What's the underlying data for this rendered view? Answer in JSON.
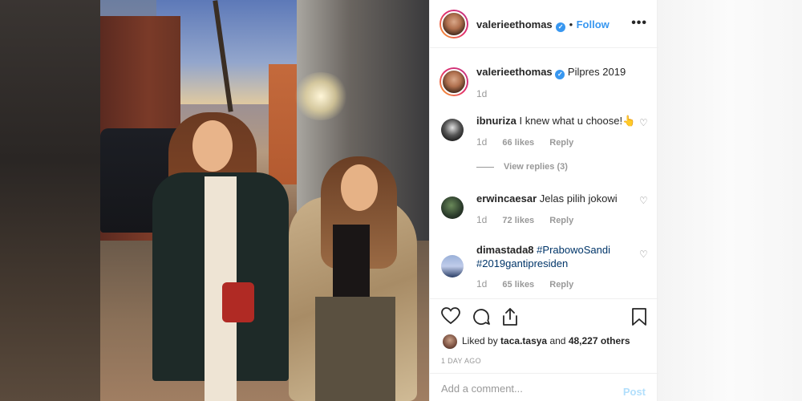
{
  "post": {
    "author": "valerieethomas",
    "follow_label": "Follow",
    "dot": "•",
    "more_label": "•••",
    "caption": {
      "user": "valerieethomas",
      "text": "Pilpres 2019",
      "time": "1d"
    }
  },
  "comments": [
    {
      "user": "ibnuriza",
      "text": "I knew what u choose!",
      "emoji": "👆",
      "time": "1d",
      "likes": "66 likes",
      "reply": "Reply",
      "view_replies": "View replies (3)"
    },
    {
      "user": "erwincaesar",
      "text": "Jelas pilih jokowi",
      "time": "1d",
      "likes": "72 likes",
      "reply": "Reply"
    },
    {
      "user": "dimastada8",
      "hashtag1": "#PrabowoSandi",
      "hashtag2": "#2019gantipresiden",
      "time": "1d",
      "likes": "65 likes",
      "reply": "Reply"
    }
  ],
  "likes_line": {
    "prefix": "Liked by",
    "user": "taca.tasya",
    "and": "and",
    "count": "48,227 others"
  },
  "date": "1 DAY AGO",
  "add_comment": {
    "placeholder": "Add a comment...",
    "post_label": "Post"
  },
  "icons": [
    "heart-icon",
    "comment-icon",
    "share-icon",
    "bookmark-icon",
    "more-icon",
    "verified-icon"
  ],
  "colors": {
    "accent": "#3897f0",
    "hashtag": "#003569",
    "muted": "#999999",
    "post_disabled": "#b2dffc"
  }
}
